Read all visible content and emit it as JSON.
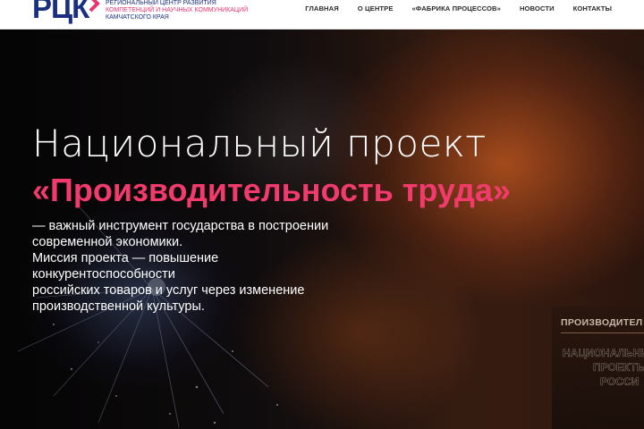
{
  "header": {
    "logo": {
      "letters": "РЦК",
      "line1": "РЕГИОНАЛЬНЫЙ ЦЕНТР РАЗВИТИЯ",
      "line2": "КОМПЕТЕНЦИЙ И НАУЧНЫХ КОММУНИКАЦИЙ",
      "line3": "КАМЧАТСКОГО КРАЯ"
    },
    "nav": [
      {
        "label": "ГЛАВНАЯ"
      },
      {
        "label": "О ЦЕНТРЕ"
      },
      {
        "label": "«ФАБРИКА ПРОЦЕССОВ»"
      },
      {
        "label": "НОВОСТИ"
      },
      {
        "label": "КОНТАКТЫ"
      }
    ]
  },
  "hero": {
    "title": "Национальный  проект",
    "subtitle": "«Производительность труда»",
    "description": [
      "— важный инструмент государства в построении",
      "современной экономики.",
      "Миссия проекта — повышение конкурентоспособности",
      "российских товаров и услуг через изменение",
      "производственной культуры."
    ],
    "poster": {
      "top": "ПРОИЗВОДИТЕЛ",
      "lines": [
        "НАЦИОНАЛЬНЫ",
        "ПРОЕКТЬ",
        "РОССИ"
      ]
    }
  },
  "colors": {
    "brand_blue": "#1b2f80",
    "brand_pink": "#e8356d",
    "accent_pink": "#f23b6c"
  }
}
